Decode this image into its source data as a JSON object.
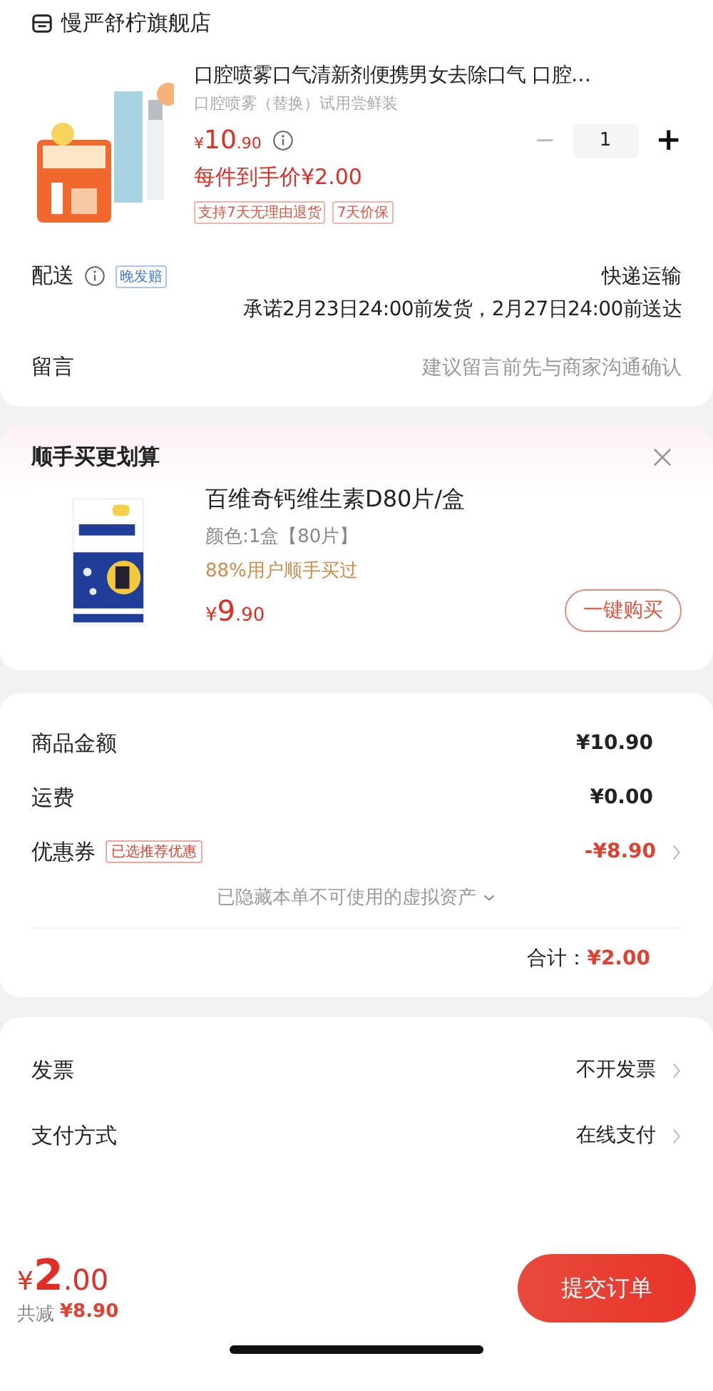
{
  "store": {
    "name": "慢严舒柠旗舰店"
  },
  "product": {
    "kind": "picture",
    "title": "口腔喷雾口气清新剂便携男女去除口气 口腔…",
    "variant": "口腔喷雾（替换）试用尝鲜装",
    "price_symbol": "¥",
    "price_int": "10",
    "price_dec": ".90",
    "final_price": "每件到手价¥2.00",
    "minus": "−",
    "quantity": "1",
    "plus": "+",
    "tags": [
      "支持7天无理由退货",
      "7天价保"
    ]
  },
  "delivery": {
    "label": "配送",
    "badge": "晚发赔",
    "method": "快递运输",
    "promise": "承诺2月23日24:00前发货，2月27日24:00前送达"
  },
  "note": {
    "label": "留言",
    "placeholder": "建议留言前先与商家沟通确认"
  },
  "addon": {
    "title": "顺手买更划算",
    "item": {
      "kind": "picture",
      "name": "百维奇钙维生素D80片/盒",
      "spec": "颜色:1盒【80片】",
      "social": "88%用户顺手买过",
      "price_symbol": "¥",
      "price_int": "9",
      "price_dec": ".90",
      "button": "一键购买"
    }
  },
  "summary": {
    "rows": [
      {
        "kind": "plain",
        "label": "商品金额",
        "value": "¥10.90"
      },
      {
        "kind": "plain",
        "label": "运费",
        "value": "¥0.00"
      },
      {
        "kind": "coupon",
        "label": "优惠券",
        "tag": "已选推荐优惠",
        "value": "-¥8.90"
      }
    ],
    "hidden_note": "已隐藏本单不可使用的虚拟资产",
    "total_label": "合计：",
    "total_value": "¥2.00"
  },
  "options": [
    {
      "label": "发票",
      "value": "不开发票"
    },
    {
      "label": "支付方式",
      "value": "在线支付"
    }
  ],
  "footer": {
    "price_symbol": "¥",
    "price_int": "2",
    "price_dec": ".00",
    "saving_label": "共减",
    "saving_value": "¥8.90",
    "submit": "提交订单"
  }
}
